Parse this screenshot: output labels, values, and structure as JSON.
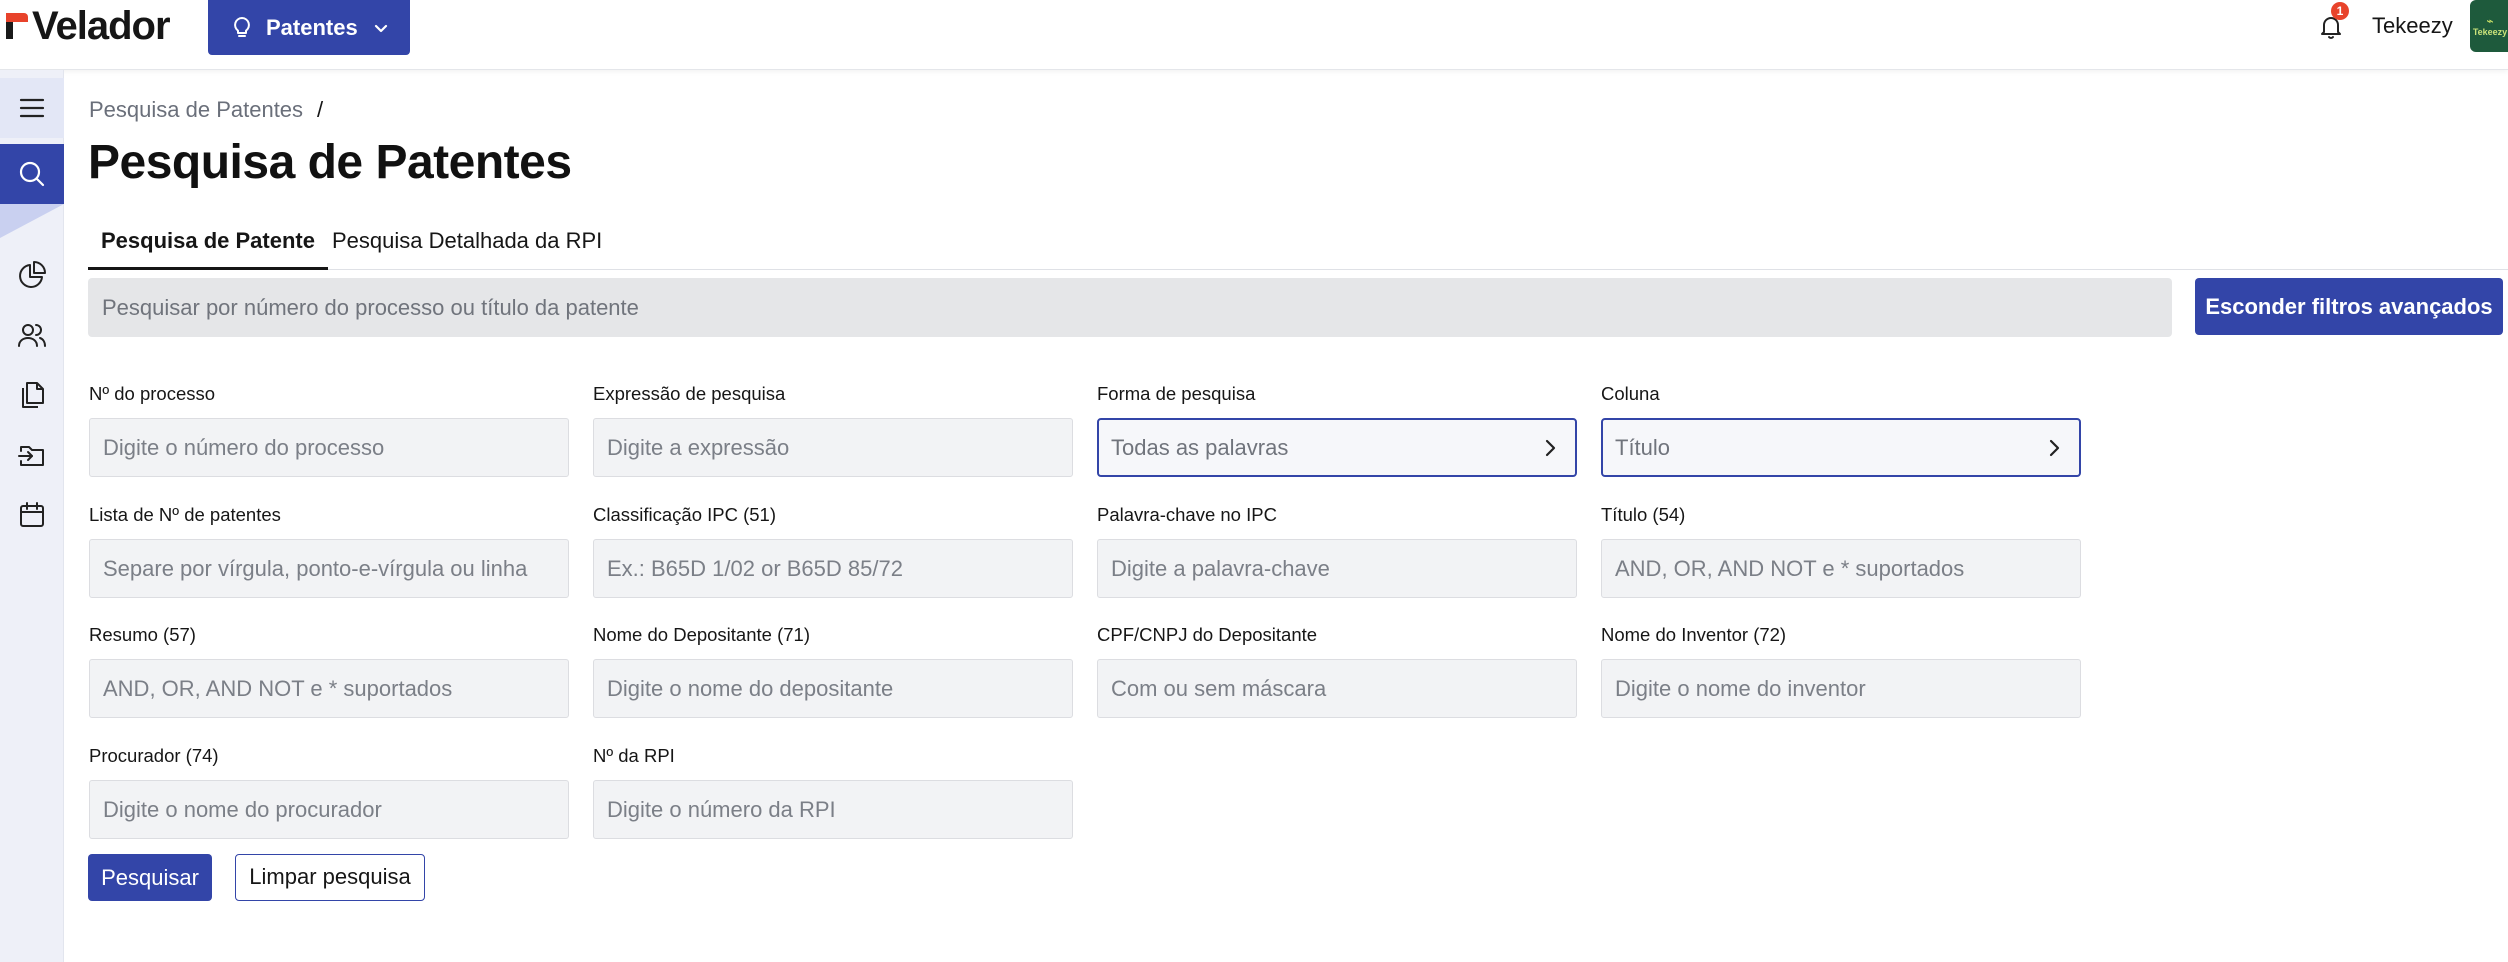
{
  "header": {
    "logo_text": "Velador",
    "module_button_label": "Patentes",
    "notification_count": "1",
    "user_name": "Tekeezy",
    "avatar_text": "Tekeezy"
  },
  "breadcrumb": {
    "item": "Pesquisa de Patentes",
    "separator": "/"
  },
  "page_title": "Pesquisa de Patentes",
  "tabs": [
    {
      "label": "Pesquisa de Patente",
      "active": true
    },
    {
      "label": "Pesquisa Detalhada da RPI",
      "active": false
    }
  ],
  "search": {
    "placeholder": "Pesquisar por número do processo ou título da patente",
    "toggle_filters_label": "Esconder filtros avançados"
  },
  "filters": {
    "process_number": {
      "label": "Nº do processo",
      "placeholder": "Digite o número do processo"
    },
    "search_expression": {
      "label": "Expressão de pesquisa",
      "placeholder": "Digite a expressão"
    },
    "search_mode": {
      "label": "Forma de pesquisa",
      "value": "Todas as palavras"
    },
    "column": {
      "label": "Coluna",
      "value": "Título"
    },
    "patent_list": {
      "label": "Lista de Nº de patentes",
      "placeholder": "Separe por vírgula, ponto-e-vírgula ou linha"
    },
    "ipc_classification": {
      "label": "Classificação IPC (51)",
      "placeholder": "Ex.: B65D 1/02 or B65D 85/72"
    },
    "ipc_keyword": {
      "label": "Palavra-chave no IPC",
      "placeholder": "Digite a palavra-chave"
    },
    "title": {
      "label": "Título (54)",
      "placeholder": "AND, OR, AND NOT e * suportados"
    },
    "abstract": {
      "label": "Resumo (57)",
      "placeholder": "AND, OR, AND NOT e * suportados"
    },
    "applicant_name": {
      "label": "Nome do Depositante (71)",
      "placeholder": "Digite o nome do depositante"
    },
    "applicant_id": {
      "label": "CPF/CNPJ do Depositante",
      "placeholder": "Com ou sem máscara"
    },
    "inventor_name": {
      "label": "Nome do Inventor (72)",
      "placeholder": "Digite o nome do inventor"
    },
    "attorney": {
      "label": "Procurador (74)",
      "placeholder": "Digite o nome do procurador"
    },
    "rpi_number": {
      "label": "Nº da RPI",
      "placeholder": "Digite o número da RPI"
    }
  },
  "actions": {
    "search_label": "Pesquisar",
    "clear_label": "Limpar pesquisa"
  },
  "colors": {
    "primary": "#3345a8",
    "accent": "#e8432b",
    "rail_background": "#eef0f8"
  },
  "icons": {
    "rail": [
      "menu-icon",
      "search-icon",
      "pie-chart-icon",
      "users-icon",
      "documents-icon",
      "folder-import-icon",
      "calendar-icon"
    ],
    "header": [
      "lightbulb-icon",
      "chevron-down-icon",
      "bell-icon"
    ]
  }
}
